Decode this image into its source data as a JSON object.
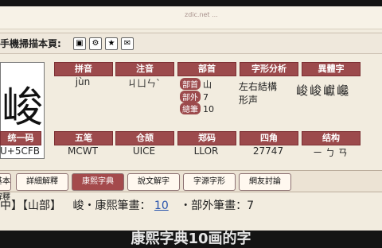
{
  "banner": {
    "text": "zdic.net ..."
  },
  "toolbar": {
    "title": "手機掃描本頁:",
    "icons": [
      "qr-icon",
      "gear-icon",
      "star-icon",
      "mail-icon"
    ]
  },
  "character": {
    "glyph": "峻",
    "cells": [
      {
        "label": "拼音",
        "value": "jùn"
      },
      {
        "label": "注音",
        "value": "ㄐㄩㄣˋ"
      },
      {
        "label": "部首",
        "value": "山"
      },
      {
        "label": "部外笔画",
        "value": "7"
      },
      {
        "label": "总笔画",
        "value": "10"
      },
      {
        "label": "五笔",
        "value": "MCWT"
      },
      {
        "label": "仓颉",
        "value": "UICE"
      },
      {
        "label": "郑码",
        "value": "LLOR"
      },
      {
        "label": "四角",
        "value": "27747"
      },
      {
        "label": "结构",
        "value": "ㄧ ㄅ ㄢ"
      },
      {
        "label": "统一码",
        "value": "U+5CFB"
      }
    ],
    "structure_text": "左右結構",
    "stroke_detail": "形声",
    "traditional": "峻峻巘巉"
  },
  "tabs": [
    {
      "label": "基本解釋"
    },
    {
      "label": "詳細解釋"
    },
    {
      "label": "康熙字典"
    },
    {
      "label": "說文解字"
    },
    {
      "label": "字源字形"
    },
    {
      "label": "網友討論"
    }
  ],
  "lookup": {
    "prefix": "中】【山部】",
    "mid": "峻・康熙筆畫：",
    "kangxi": "10",
    "suffix": "・部外筆畫：7"
  },
  "subtitle": "康熙字典10画的字"
}
